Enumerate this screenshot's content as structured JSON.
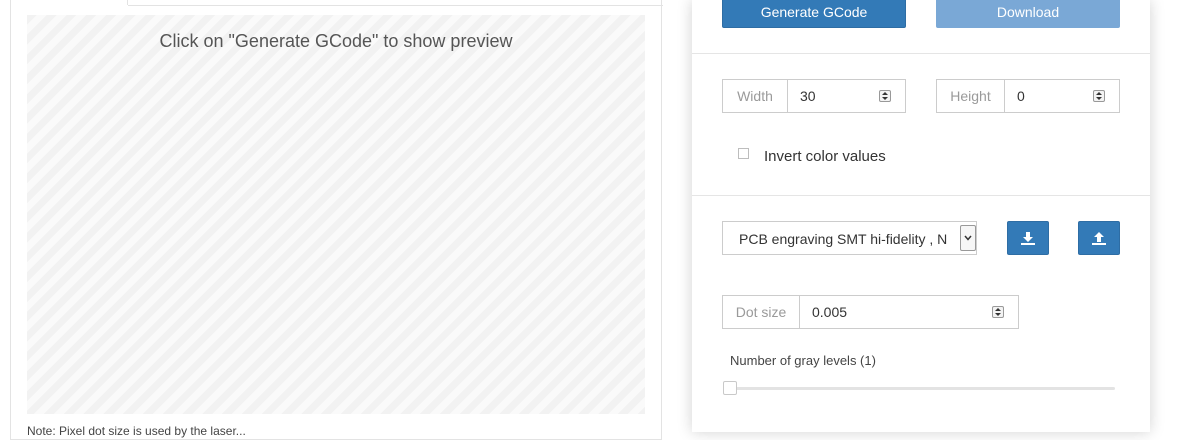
{
  "preview": {
    "message": "Click on \"Generate GCode\" to show preview",
    "note": "Note: Pixel dot size is used by the laser..."
  },
  "actions": {
    "generate_label": "Generate GCode",
    "download_label": "Download"
  },
  "dimensions": {
    "width_label": "Width",
    "width_value": "30",
    "height_label": "Height",
    "height_value": "0"
  },
  "options": {
    "invert_label": "Invert color values",
    "invert_checked": false
  },
  "profile": {
    "selected": "PCB engraving SMT hi-fidelity , N",
    "download_icon": "download-icon",
    "upload_icon": "upload-icon"
  },
  "dot": {
    "label": "Dot size",
    "value": "0.005"
  },
  "gray": {
    "label": "Number of gray levels (1)",
    "level": 1
  },
  "colors": {
    "primary": "#337ab7",
    "disabled": "#7aa8d6"
  }
}
